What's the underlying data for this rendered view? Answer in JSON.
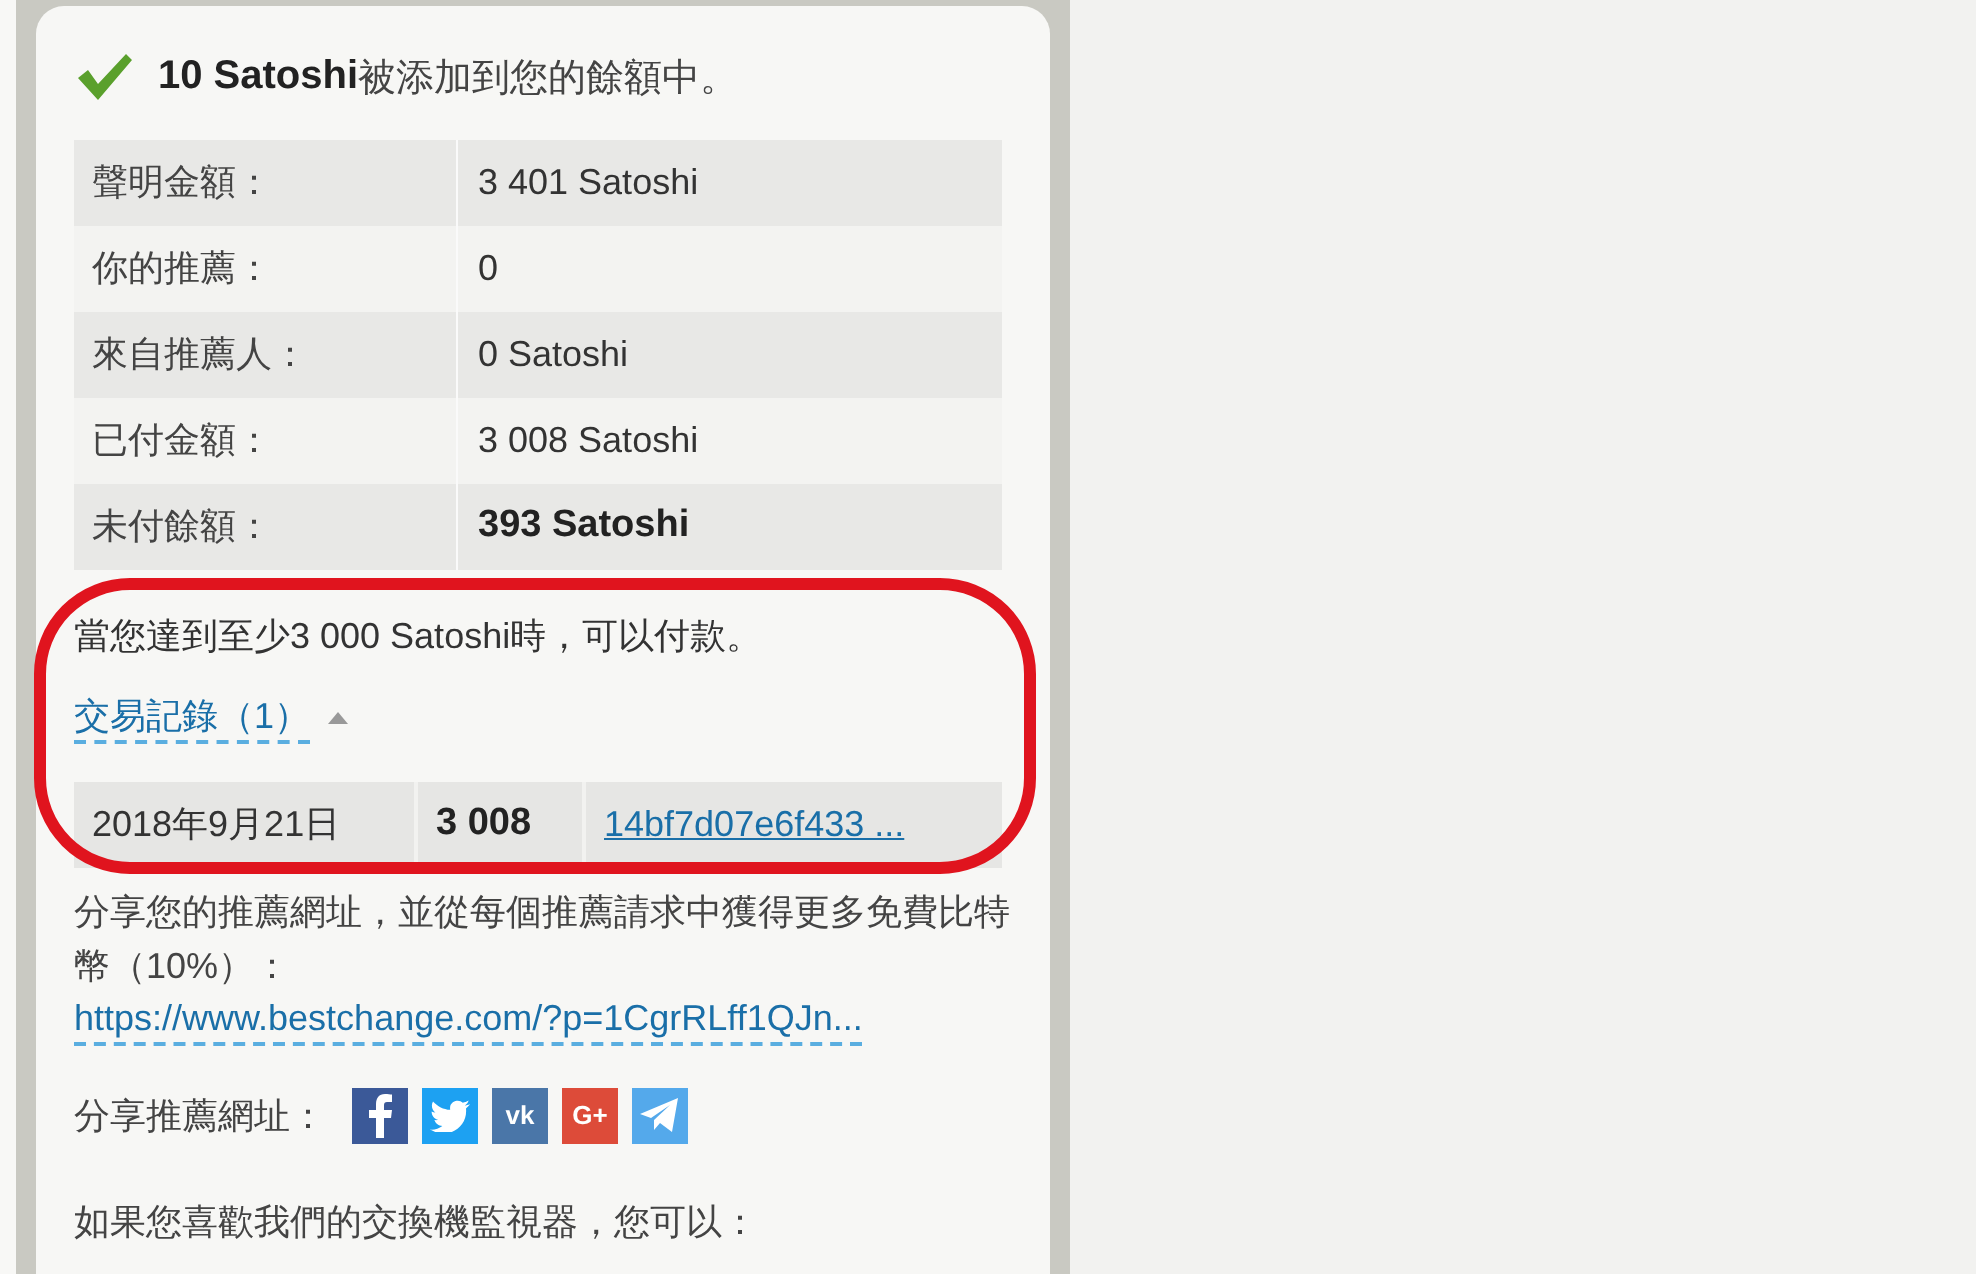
{
  "notice": {
    "amount": "10 Satoshi",
    "message": "被添加到您的餘額中。"
  },
  "balance_rows": [
    {
      "label": "聲明金額：",
      "value": "3 401 Satoshi",
      "bold": false
    },
    {
      "label": "你的推薦：",
      "value": "0",
      "bold": false
    },
    {
      "label": "來自推薦人：",
      "value": "0 Satoshi",
      "bold": false
    },
    {
      "label": "已付金額：",
      "value": "3 008 Satoshi",
      "bold": false
    },
    {
      "label": "未付餘額：",
      "value": "393 Satoshi",
      "bold": true
    }
  ],
  "payout_note": "當您達到至少3 000 Satoshi時，可以付款。",
  "transactions": {
    "label": "交易記錄（1）",
    "expanded": true,
    "rows": [
      {
        "date": "2018年9月21日",
        "amount": "3 008",
        "tx": "14bf7d07e6f433 ..."
      }
    ]
  },
  "referral_text": "分享您的推薦網址，並從每個推薦請求中獲得更多免費比特幣（10%）：",
  "referral_link": "https://www.bestchange.com/?p=1CgrRLff1QJn...",
  "share": {
    "label": "分享推薦網址：",
    "icons": [
      {
        "kind": "facebook"
      },
      {
        "kind": "twitter"
      },
      {
        "kind": "vk",
        "label": "vk"
      },
      {
        "kind": "google-plus",
        "label": "G+"
      },
      {
        "kind": "telegram"
      }
    ]
  },
  "footer_text": "如果您喜歡我們的交換機監視器，您可以："
}
